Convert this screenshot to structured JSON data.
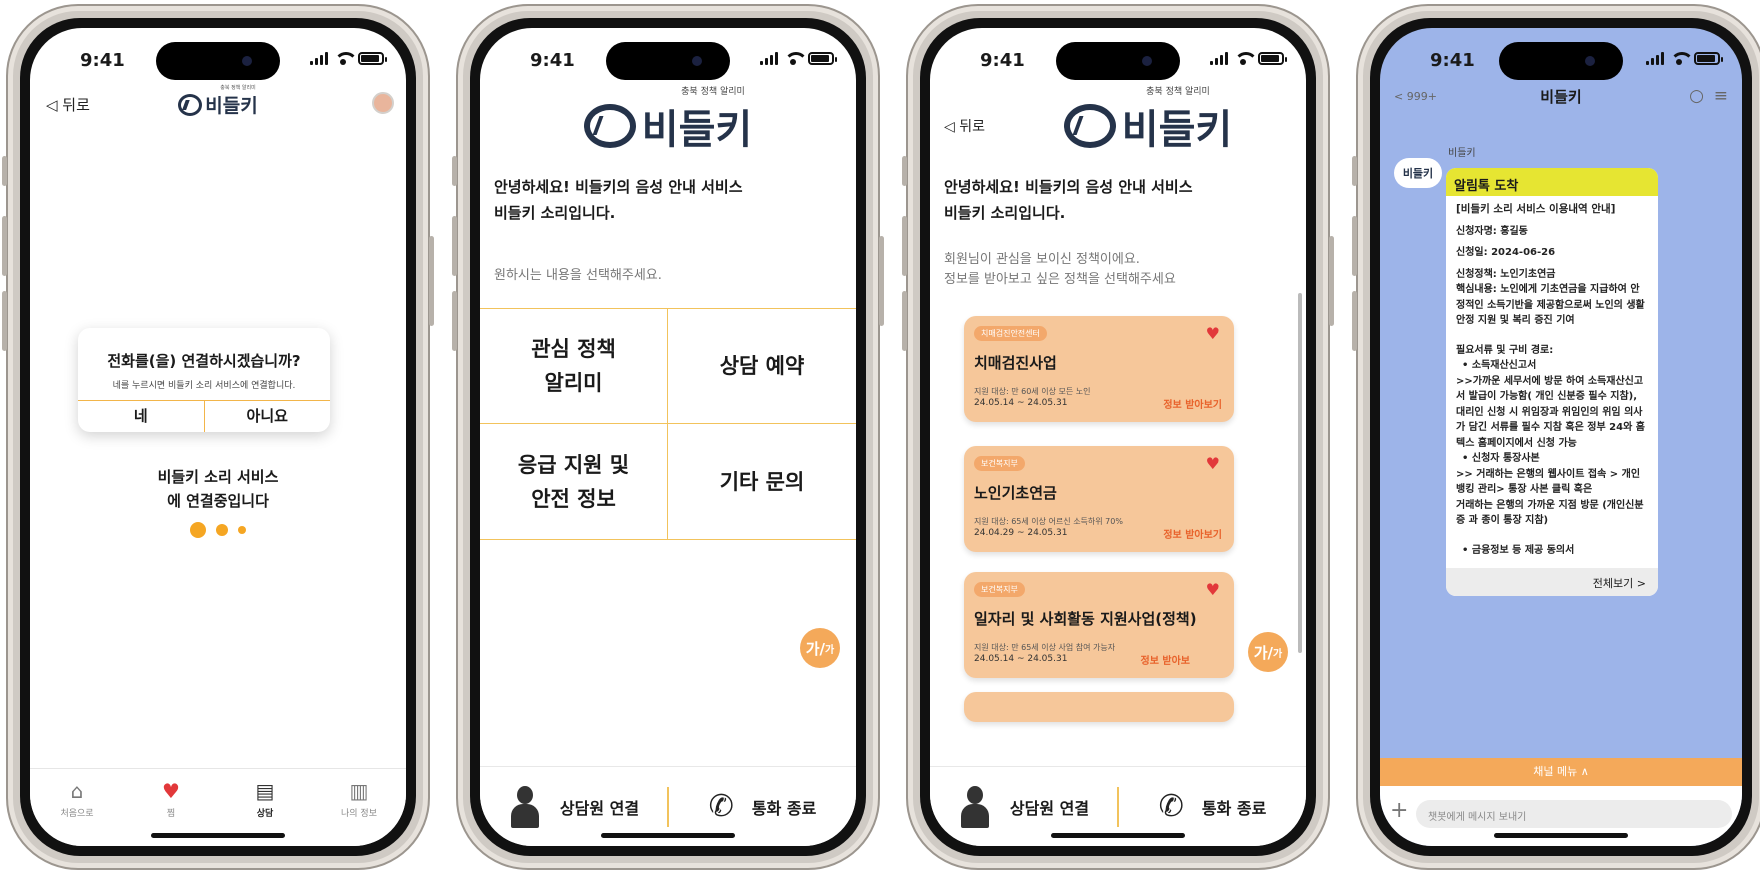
{
  "status": {
    "time": "9:41"
  },
  "screen1": {
    "back": "◁ 뒤로",
    "logo_caption": "충북 정책 알리미",
    "logo_text": "비들키",
    "dialog": {
      "title": "전화를(을) 연결하시겠습니까?",
      "subtitle": "네를 누르시면 비들키 소리 서비스에 연결합니다.",
      "yes": "네",
      "no": "아니요"
    },
    "connecting_line1": "비들키 소리 서비스",
    "connecting_line2": "에 연결중입니다",
    "tabs": [
      {
        "label": "처음으로",
        "icon": "home-icon"
      },
      {
        "label": "찜",
        "icon": "heart-icon"
      },
      {
        "label": "상담",
        "icon": "chat-icon"
      },
      {
        "label": "나의 정보",
        "icon": "books-icon"
      }
    ]
  },
  "screen2": {
    "logo_caption": "충북 정책 알리미",
    "logo_text": "비들키",
    "greeting_line1": "안녕하세요! 비들키의 음성 안내 서비스",
    "greeting_line2": "비들키 소리입니다.",
    "prompt": "원하시는 내용을 선택해주세요.",
    "options": [
      {
        "line1": "관심 정책",
        "line2": "알리미"
      },
      {
        "line1": "상담 예약",
        "line2": ""
      },
      {
        "line1": "응급 지원 및",
        "line2": "안전 정보"
      },
      {
        "line1": "기타 문의",
        "line2": ""
      }
    ],
    "font_fab": "가/",
    "font_fab_small": "가",
    "call_agent": "상담원 연결",
    "call_end": "통화 종료"
  },
  "screen3": {
    "back": "◁ 뒤로",
    "logo_caption": "충북 정책 알리미",
    "logo_text": "비들키",
    "greeting_line1": "안녕하세요! 비들키의 음성 안내 서비스",
    "greeting_line2": "비들키 소리입니다.",
    "prompt_line1": "회원님이 관심을 보이신 정책이에요.",
    "prompt_line2": "정보를 받아보고 싶은 정책을 선택해주세요",
    "cards": [
      {
        "badge": "치매검진안전센터",
        "name": "치매검진사업",
        "target": "지원 대상: 만 60세 이상 모든 노인",
        "period": "24.05.14 ~ 24.05.31",
        "more": "정보 받아보기"
      },
      {
        "badge": "보건복지부",
        "name": "노인기초연금",
        "target": "지원 대상: 65세 이상 어르신 소득하위 70%",
        "period": "24.04.29 ~ 24.05.31",
        "more": "정보 받아보기"
      },
      {
        "badge": "보건복지부",
        "name": "일자리 및 사회활동 지원사업(정책)",
        "target": "지원 대상: 만 65세 이상 사업 참여 가능자",
        "period": "24.05.14 ~ 24.05.31",
        "more": "정보 받아보"
      }
    ],
    "font_fab": "가/",
    "font_fab_small": "가",
    "call_agent": "상담원 연결",
    "call_end": "통화 종료"
  },
  "screen4": {
    "back_count": "< 999+",
    "title": "비들키",
    "sender": "비들키",
    "chip": "비들키",
    "bubble_header": "알림톡 도착",
    "bubble_title": "[비들키 소리 서비스 이용내역 안내]",
    "applicant": "신청자명: 홍길동",
    "date": "신청일: 2024-06-26",
    "policy": "신청정책: 노인기초연금",
    "core": "핵심내용: 노인에게 기초연금을 지급하여 안정적인 소득기반을 제공함으로써 노인의 생활 안정 지원 및 복리 증진 기여",
    "docs_title": "필요서류 및 구비 경로:",
    "doc1": "•  소득재산신고서",
    "doc1_desc": ">>가까운 세무서에 방문 하여 소득재산신고서 발급이 가능함( 개인 신분증 필수 지참), 대리인 신청 시  위임장과 위임인의 위임 의사가 담긴 서류를 필수 지참  혹은 정부 24와 홈텍스 홈페이지에서 신청 가능",
    "doc2": "•  신청자 통장사본",
    "doc2_desc": ">> 거래하는 은행의 웹사이트 접속 > 개인뱅킹 관리> 통장 사본 클릭 혹은\n거래하는 은행의 가까운 지점 방문 (개인신분증 과 종이 통장 지참)",
    "doc3": "•  금융정보 등 제공 동의서",
    "view_all": "전체보기 >",
    "channel_menu": "채널 메뉴  ∧",
    "input_placeholder": "챗봇에게 메시지 보내기"
  }
}
